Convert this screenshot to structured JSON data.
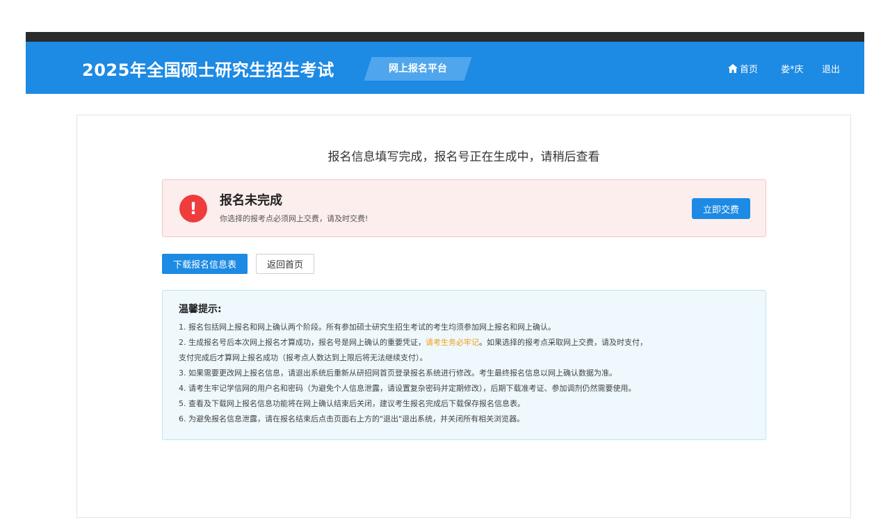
{
  "header": {
    "title": "2025年全国硕士研究生招生考试",
    "platform": "网上报名平台",
    "nav": {
      "home": "首页",
      "user": "娄*庆",
      "logout": "退出"
    }
  },
  "main": {
    "heading": "报名信息填写完成，报名号正在生成中，请稍后查看",
    "alert": {
      "icon": "!",
      "title": "报名未完成",
      "subtitle": "你选择的报考点必须网上交费，请及时交费!",
      "pay_button": "立即交费"
    },
    "download_button": "下载报名信息表",
    "back_button": "返回首页",
    "tips": {
      "title": "温馨提示:",
      "item1": "1. 报名包括网上报名和网上确认两个阶段。所有参加硕士研究生招生考试的考生均须参加网上报名和网上确认。",
      "item2_a": "2. 生成报名号后本次网上报名才算成功，报名号是网上确认的重要凭证，",
      "item2_hl": "请考生务必牢记",
      "item2_b": "。如果选择的报考点采取网上交费，请及时支付，",
      "item2_c": "支付完成后才算网上报名成功（报考点人数达到上限后将无法继续支付）。",
      "item3": "3. 如果需要更改网上报名信息，请退出系统后重新从研招网首页登录报名系统进行修改。考生最终报名信息以网上确认数据为准。",
      "item4": "4. 请考生牢记学信网的用户名和密码（为避免个人信息泄露，请设置复杂密码并定期修改），后期下载准考证、参加调剂仍然需要使用。",
      "item5": "5. 查看及下载网上报名信息功能将在网上确认结束后关闭，建议考生报名完成后下载保存报名信息表。",
      "item6": "6. 为避免报名信息泄露，请在报名结束后点击页面右上方的\"退出\"退出系统，并关闭所有相关浏览器。"
    }
  },
  "colors": {
    "brand": "#1d8ae3",
    "alert_bg": "#fdeeee",
    "alert_icon": "#ef3c3c",
    "highlight": "#f39c12",
    "tips_bg": "#eef8fd"
  },
  "icons": {
    "home": "home-icon",
    "alert": "exclamation-icon"
  }
}
